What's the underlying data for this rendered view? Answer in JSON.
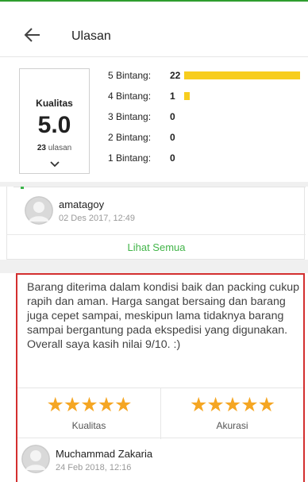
{
  "header": {
    "title": "Ulasan"
  },
  "summary": {
    "label": "Kualitas",
    "score": "5.0",
    "count": "23",
    "count_unit": "ulasan",
    "max_count": 22,
    "rows": [
      {
        "label": "5 Bintang:",
        "count": "22",
        "value": 22
      },
      {
        "label": "4 Bintang:",
        "count": "1",
        "value": 1
      },
      {
        "label": "3 Bintang:",
        "count": "0",
        "value": 0
      },
      {
        "label": "2 Bintang:",
        "count": "0",
        "value": 0
      },
      {
        "label": "1 Bintang:",
        "count": "0",
        "value": 0
      }
    ]
  },
  "review1": {
    "name": "amatagoy",
    "date": "02 Des 2017, 12:49",
    "see_all": "Lihat Semua"
  },
  "review2": {
    "text": "Barang diterima dalam kondisi baik dan packing cukup rapih dan aman. Harga sangat bersaing dan barang juga cepet sampai, meskipun lama tidaknya barang sampai bergantung pada ekspedisi yang digunakan. Overall saya kasih nilai 9/10. :)",
    "quality_label": "Kualitas",
    "quality_stars": 5,
    "accuracy_label": "Akurasi",
    "accuracy_stars": 5,
    "name": "Muchammad Zakaria",
    "date": "24 Feb 2018, 12:16"
  },
  "colors": {
    "accent": "#42b549",
    "bar": "#f7cd1e",
    "star": "#f5a623",
    "highlight": "#d32f2f"
  }
}
